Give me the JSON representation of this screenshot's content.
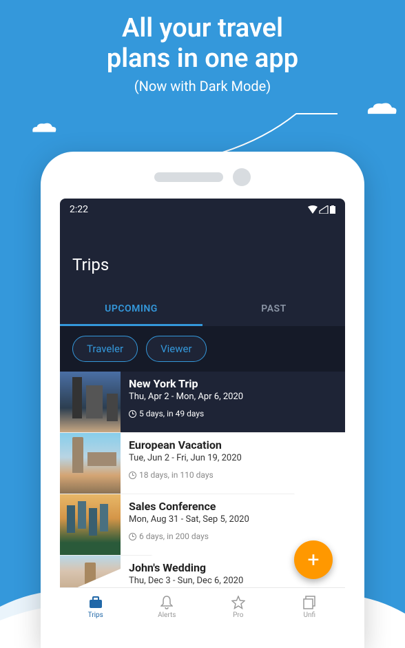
{
  "hero": {
    "title_line1": "All your travel",
    "title_line2": "plans in one app",
    "subtitle": "(Now with Dark Mode)"
  },
  "status": {
    "time": "2:22"
  },
  "screen": {
    "title": "Trips"
  },
  "tabs": {
    "upcoming": "UPCOMING",
    "past": "PAST"
  },
  "chips": {
    "traveler": "Traveler",
    "viewer": "Viewer"
  },
  "trips": [
    {
      "title": "New York Trip",
      "dates": "Thu, Apr 2 - Mon, Apr 6, 2020",
      "meta": "5 days, in 49 days"
    },
    {
      "title": "European Vacation",
      "dates": "Tue, Jun 2 - Fri, Jun 19, 2020",
      "meta": "18 days, in 110 days"
    },
    {
      "title": "Sales Conference",
      "dates": "Mon, Aug 31 - Sat, Sep 5, 2020",
      "meta": "6 days, in 200 days"
    },
    {
      "title": "John's Wedding",
      "dates": "Thu, Dec 3 - Sun, Dec 6, 2020",
      "meta": ""
    }
  ],
  "fab": {
    "label": "+"
  },
  "nav": {
    "items": [
      {
        "label": "Trips"
      },
      {
        "label": "Alerts"
      },
      {
        "label": "Pro"
      },
      {
        "label": "Unfi"
      }
    ]
  }
}
